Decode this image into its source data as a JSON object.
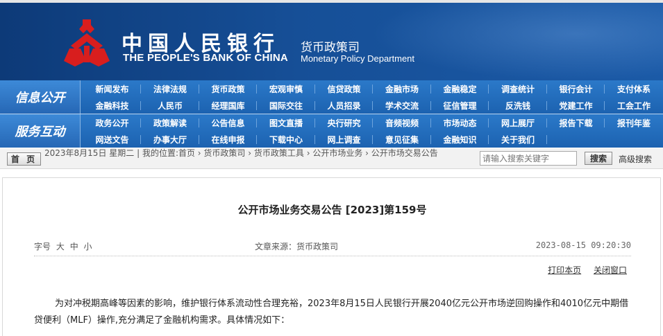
{
  "header": {
    "cn_name": "中国人民银行",
    "en_name": "THE PEOPLE'S BANK OF CHINA",
    "dept_cn": "货币政策司",
    "dept_en": "Monetary Policy Department",
    "logo_icon": "pboc-logo-icon",
    "brand_colors": {
      "banner": "#164f97",
      "logo": "#d81e1e"
    }
  },
  "nav": {
    "section1": "信息公开",
    "section2": "服务互动",
    "row1": [
      "新闻发布",
      "法律法规",
      "货币政策",
      "宏观审慎",
      "信贷政策",
      "金融市场",
      "金融稳定",
      "调查统计",
      "银行会计",
      "支付体系",
      "金融科技",
      "人民币",
      "经理国库",
      "国际交往",
      "人员招录",
      "学术交流",
      "征信管理",
      "反洗钱",
      "党建工作",
      "工会工作"
    ],
    "row2": [
      "政务公开",
      "政策解读",
      "公告信息",
      "图文直播",
      "央行研究",
      "音频视频",
      "市场动态",
      "网上展厅",
      "报告下载",
      "报刊年鉴",
      "网送文告",
      "办事大厅",
      "在线申报",
      "下载中心",
      "网上调查",
      "意见征集",
      "金融知识",
      "关于我们"
    ]
  },
  "crumbs": {
    "home_label": "首 页",
    "date": "2023年8月15日 星期二",
    "location_prefix": "我的位置:首页",
    "items": [
      "货币政策司",
      "货币政策工具",
      "公开市场业务",
      "公开市场交易公告"
    ],
    "search_placeholder": "请输入搜索关键字",
    "search_button": "搜索",
    "advanced_search": "高级搜索"
  },
  "article": {
    "title": "公开市场业务交易公告 [2023]第159号",
    "font_size_label": "字号",
    "font_sizes": [
      "大",
      "中",
      "小"
    ],
    "source": "文章来源：货币政策司",
    "datetime": "2023-08-15 09:20:30",
    "print_label": "打印本页",
    "close_label": "关闭窗口",
    "body": "为对冲税期高峰等因素的影响，维护银行体系流动性合理充裕，2023年8月15日人民银行开展2040亿元公开市场逆回购操作和4010亿元中期借贷便利（MLF）操作,充分满足了金融机构需求。具体情况如下："
  }
}
